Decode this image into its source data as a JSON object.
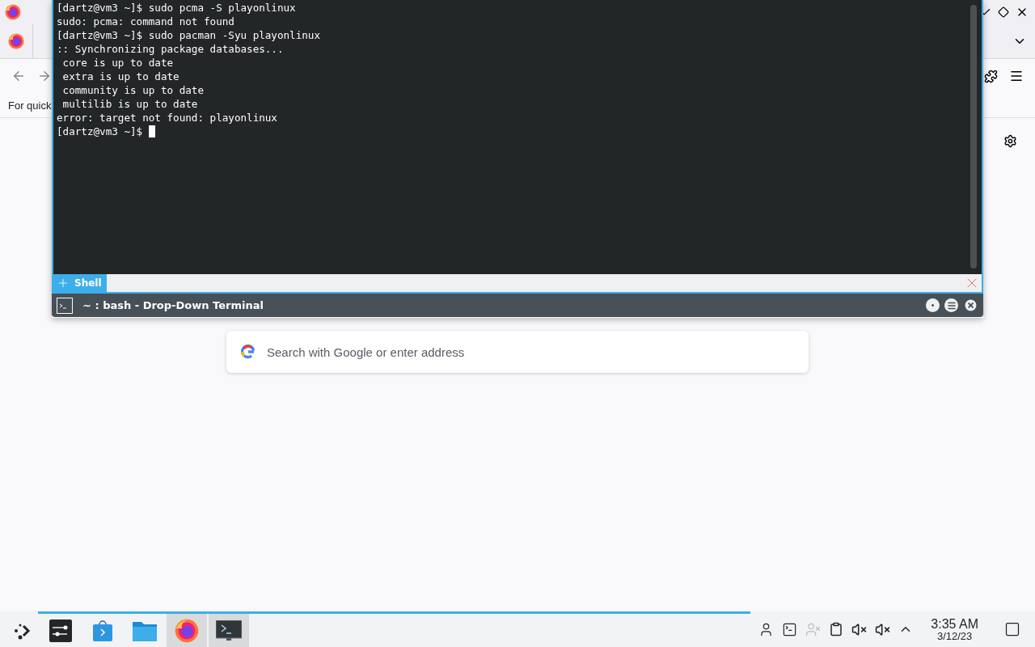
{
  "browser": {
    "bookmarks_hint": "For quick",
    "search": {
      "placeholder": "Search with Google or enter address"
    }
  },
  "terminal": {
    "lines": [
      "[dartz@vm3 ~]$ sudo pcma -S playonlinux",
      "sudo: pcma: command not found",
      "[dartz@vm3 ~]$ sudo pacman -Syu playonlinux",
      ":: Synchronizing package databases...",
      " core is up to date",
      " extra is up to date",
      " community is up to date",
      " multilib is up to date",
      "error: target not found: playonlinux",
      "[dartz@vm3 ~]$ "
    ],
    "tabs": [
      {
        "label": "Shell",
        "selected": true
      }
    ],
    "title": "~ : bash - Drop-Down Terminal"
  },
  "taskbar": {
    "tasks": [
      {
        "kind": "settings",
        "active": false
      },
      {
        "kind": "store",
        "active": false
      },
      {
        "kind": "files",
        "active": false
      },
      {
        "kind": "firefox",
        "active": true
      },
      {
        "kind": "terminal",
        "active": true
      }
    ],
    "clock": {
      "time": "3:35 AM",
      "date": "3/12/23"
    }
  }
}
